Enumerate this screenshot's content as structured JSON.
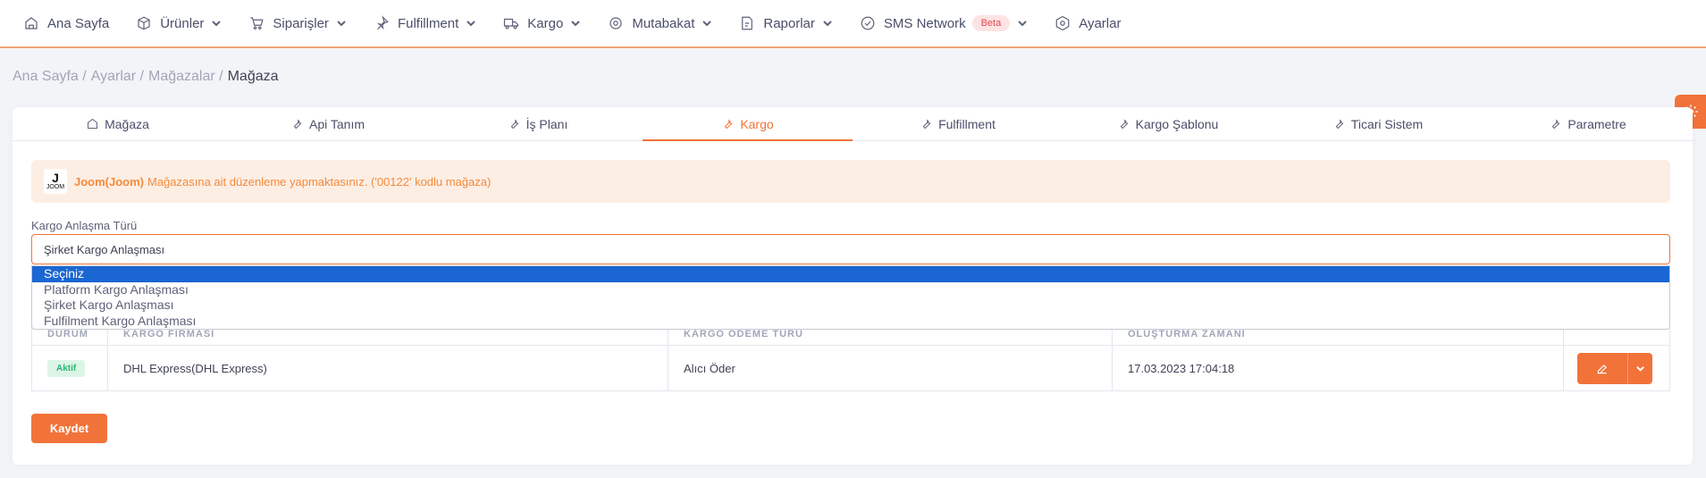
{
  "nav": {
    "items": [
      {
        "label": "Ana Sayfa",
        "icon": "home-icon",
        "has_caret": false
      },
      {
        "label": "Ürünler",
        "icon": "box-icon",
        "has_caret": true
      },
      {
        "label": "Siparişler",
        "icon": "cart-icon",
        "has_caret": true
      },
      {
        "label": "Fulfillment",
        "icon": "pin-icon",
        "has_caret": true
      },
      {
        "label": "Kargo",
        "icon": "truck-icon",
        "has_caret": true
      },
      {
        "label": "Mutabakat",
        "icon": "cog-icon",
        "has_caret": true
      },
      {
        "label": "Raporlar",
        "icon": "report-icon",
        "has_caret": true
      },
      {
        "label": "SMS Network",
        "icon": "check-circle-icon",
        "has_caret": true,
        "badge": "Beta"
      },
      {
        "label": "Ayarlar",
        "icon": "settings-hex-icon",
        "has_caret": false
      }
    ]
  },
  "breadcrumb": [
    "Ana Sayfa /",
    "Ayarlar /",
    "Mağazalar /",
    "Mağaza"
  ],
  "tabs": [
    "Mağaza",
    "Api Tanım",
    "İş Planı",
    "Kargo",
    "Fulfillment",
    "Kargo Şablonu",
    "Ticari Sistem",
    "Parametre"
  ],
  "active_tab": "Kargo",
  "alert": {
    "logo_letter": "J",
    "logo_text": "JOOM",
    "store_name": "Joom(Joom)",
    "message": "Mağazasına ait düzenleme yapmaktasınız. ('00122' kodlu mağaza)"
  },
  "form": {
    "label": "Kargo Anlaşma Türü",
    "selected": "Şirket Kargo Anlaşması",
    "options": [
      "Seçiniz",
      "Platform Kargo Anlaşması",
      "Şirket Kargo Anlaşması",
      "Fulfilment Kargo Anlaşması"
    ],
    "highlighted_option": "Seçiniz"
  },
  "table": {
    "headers": [
      "DURUM",
      "KARGO FİRMASI",
      "KARGO ÖDEME TÜRÜ",
      "OLUŞTURMA ZAMANI",
      ""
    ],
    "rows": [
      {
        "status": "Aktif",
        "company": "DHL Express(DHL Express)",
        "payment": "Alıcı Öder",
        "created": "17.03.2023 17:04:18"
      }
    ]
  },
  "save_label": "Kaydet",
  "colors": {
    "accent": "#f1733a",
    "select_highlight": "#1a66d2",
    "active_badge": "#2bb673"
  }
}
